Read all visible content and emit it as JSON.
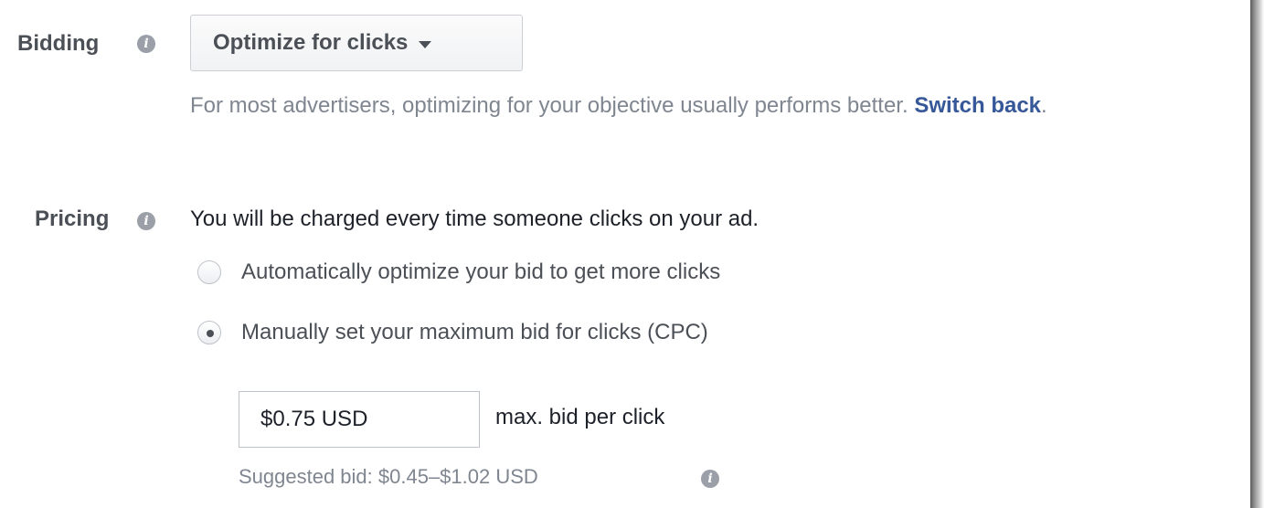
{
  "bidding": {
    "label": "Bidding",
    "dropdown_value": "Optimize for clicks",
    "note_text": "For most advertisers, optimizing for your objective usually performs better. ",
    "switch_back_link": "Switch back",
    "note_end": "."
  },
  "pricing": {
    "label": "Pricing",
    "description": "You will be charged every time someone clicks on your ad.",
    "options": [
      {
        "label": "Automatically optimize your bid to get more clicks",
        "selected": false
      },
      {
        "label": "Manually set your maximum bid for clicks (CPC)",
        "selected": true
      }
    ],
    "bid_value": "$0.75 USD",
    "bid_suffix": "max. bid per click",
    "suggested_bid": "Suggested bid: $0.45–$1.02 USD"
  },
  "icons": {
    "info": "info-icon",
    "dropdown": "caret-down-icon"
  }
}
